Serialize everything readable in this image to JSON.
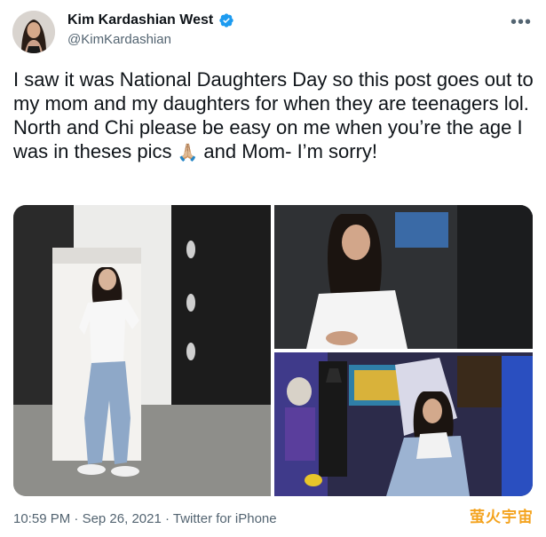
{
  "author": {
    "display_name": "Kim Kardashian West",
    "handle": "@KimKardashian",
    "verified": true
  },
  "tweet": {
    "text_before_emoji": "I saw it was National Daughters Day so this post goes out to my mom and my daughters for when they are teenagers lol. North and Chi please be easy on me when you’re the age I was in theses pics ",
    "emoji": "🙏🏼",
    "text_after_emoji": " and Mom- I’m sorry!"
  },
  "meta": {
    "time": "10:59 PM",
    "separator": "·",
    "date": "Sep 26, 2021",
    "source": "Twitter for iPhone"
  },
  "icons": {
    "more": "more-horizontal-icon",
    "verified": "verified-badge-icon"
  },
  "colors": {
    "verified_blue": "#1d9bf0",
    "text_primary": "#0f1419",
    "text_secondary": "#536471"
  },
  "watermark": "萤火宇宙"
}
